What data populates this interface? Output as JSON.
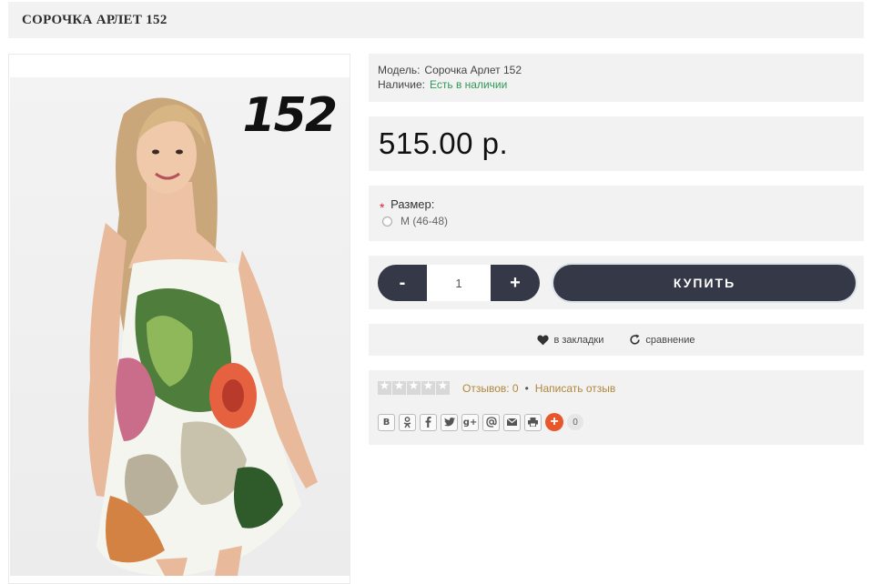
{
  "product": {
    "title": "СОРОЧКА АРЛЕТ 152",
    "image_label": "152",
    "model_label": "Модель:",
    "model_value": "Сорочка Арлет 152",
    "stock_label": "Наличие:",
    "stock_value": "Есть в наличии",
    "price": "515.00 р."
  },
  "options": {
    "required_mark": "*",
    "size_label": "Размер:",
    "size_option": "M (46-48)"
  },
  "cart": {
    "minus": "-",
    "plus": "+",
    "quantity": "1",
    "buy_label": "КУПИТЬ"
  },
  "actions": {
    "wishlist": "в закладки",
    "compare": "сравнение"
  },
  "reviews": {
    "rating": 0,
    "reviews_text": "Отзывов: 0",
    "separator": "•",
    "write_review": "Написать отзыв"
  },
  "share": {
    "buttons": [
      "В",
      "ok",
      "f",
      "twitter",
      "g+",
      "@",
      "mail",
      "print"
    ],
    "vk": "В",
    "gplus": "g+",
    "plus": "+",
    "count": "0"
  },
  "colors": {
    "panel_bg": "#f2f2f2",
    "dark_button": "#353846",
    "in_stock": "#2e9a56",
    "link": "#b0883d",
    "share_plus": "#e8572b"
  }
}
